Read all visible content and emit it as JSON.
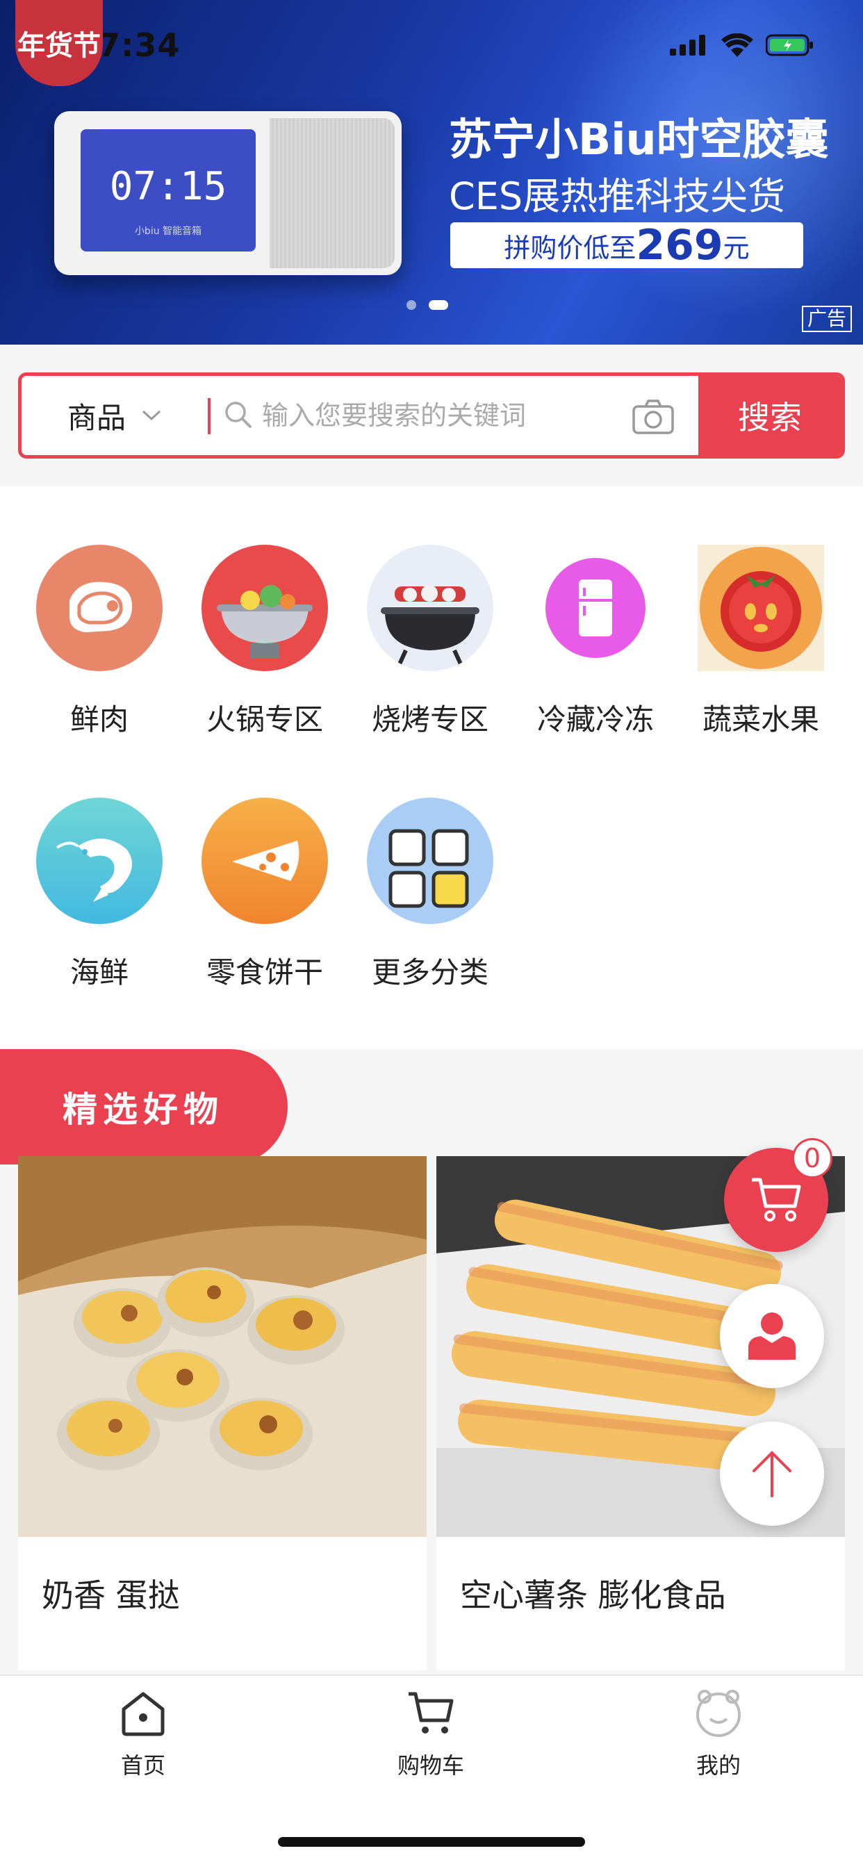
{
  "status_bar": {
    "time": "17:34"
  },
  "banner": {
    "badge_text": "年货节",
    "device_screen_time": "07:15",
    "device_screen_sub": "小biu 智能音箱",
    "title": "苏宁小Biu时空胶囊",
    "subtitle": "CES展热推科技尖货",
    "price_prefix": "拼购价低至",
    "price_value": "269",
    "price_unit": "元",
    "ad_tag": "广告",
    "active_slide": 2,
    "slide_count": 2
  },
  "search": {
    "category": "商品",
    "placeholder": "输入您要搜索的关键词",
    "button_label": "搜索"
  },
  "categories": [
    {
      "label": "鲜肉",
      "icon": "meat-icon",
      "color": "#e8866a"
    },
    {
      "label": "火锅专区",
      "icon": "hotpot-icon",
      "color": "#e94b4b"
    },
    {
      "label": "烧烤专区",
      "icon": "bbq-icon",
      "color": "#dfe9f5"
    },
    {
      "label": "冷藏冷冻",
      "icon": "fridge-icon",
      "color": "#e85ae8"
    },
    {
      "label": "蔬菜水果",
      "icon": "tomato-icon",
      "color": "#f3a34a"
    },
    {
      "label": "海鲜",
      "icon": "shrimp-icon",
      "color": "#5ccfd6"
    },
    {
      "label": "零食饼干",
      "icon": "pizza-icon",
      "color": "#f39a3a"
    },
    {
      "label": "更多分类",
      "icon": "grid-icon",
      "color": "#a9cdf5"
    }
  ],
  "picks": {
    "title": "精选好物"
  },
  "products": [
    {
      "name": "奶香 蛋挞",
      "image": "egg-tart-photo"
    },
    {
      "name": "空心薯条 膨化食品",
      "image": "puffed-fries-photo"
    }
  ],
  "cart": {
    "count": "0"
  },
  "tabbar": [
    {
      "label": "首页",
      "icon": "home-icon"
    },
    {
      "label": "购物车",
      "icon": "cart-icon"
    },
    {
      "label": "我的",
      "icon": "profile-icon"
    }
  ],
  "colors": {
    "accent": "#e9414f",
    "banner": "#1a3aa8"
  }
}
